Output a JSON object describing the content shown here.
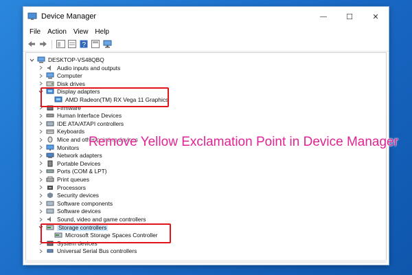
{
  "window": {
    "title": "Device Manager",
    "caption_glyphs": {
      "minimize": "—",
      "maximize": "☐",
      "close": "✕"
    }
  },
  "menu": [
    "File",
    "Action",
    "View",
    "Help"
  ],
  "toolbar_icons": [
    "back-arrow-icon",
    "forward-arrow-icon",
    "properties-icon",
    "view-list-icon",
    "help-icon",
    "details-icon",
    "computer-monitor-icon"
  ],
  "tree": {
    "root": "DESKTOP-VS48QBQ",
    "nodes": [
      {
        "label": "Audio inputs and outputs",
        "expanded": false,
        "icon": "speaker-icon"
      },
      {
        "label": "Computer",
        "expanded": false,
        "icon": "computer-icon"
      },
      {
        "label": "Disk drives",
        "expanded": false,
        "icon": "disk-icon"
      },
      {
        "label": "Display adapters",
        "expanded": true,
        "icon": "display-adapter-icon"
      },
      {
        "label": "AMD Radeon(TM) RX Vega 11 Graphics",
        "child": true,
        "icon": "display-adapter-icon"
      },
      {
        "label": "Firmware",
        "expanded": false,
        "icon": "chip-icon"
      },
      {
        "label": "Human Interface Devices",
        "expanded": false,
        "icon": "hid-icon"
      },
      {
        "label": "IDE ATA/ATAPI controllers",
        "expanded": false,
        "icon": "controller-icon"
      },
      {
        "label": "Keyboards",
        "expanded": false,
        "icon": "keyboard-icon"
      },
      {
        "label": "Mice and other pointing devices",
        "expanded": false,
        "icon": "mouse-icon"
      },
      {
        "label": "Monitors",
        "expanded": false,
        "icon": "monitor-icon"
      },
      {
        "label": "Network adapters",
        "expanded": false,
        "icon": "network-icon"
      },
      {
        "label": "Portable Devices",
        "expanded": false,
        "icon": "portable-icon"
      },
      {
        "label": "Ports (COM & LPT)",
        "expanded": false,
        "icon": "port-icon"
      },
      {
        "label": "Print queues",
        "expanded": false,
        "icon": "printer-icon"
      },
      {
        "label": "Processors",
        "expanded": false,
        "icon": "processor-icon"
      },
      {
        "label": "Security devices",
        "expanded": false,
        "icon": "security-icon"
      },
      {
        "label": "Software components",
        "expanded": false,
        "icon": "software-icon"
      },
      {
        "label": "Software devices",
        "expanded": false,
        "icon": "software-icon"
      },
      {
        "label": "Sound, video and game controllers",
        "expanded": false,
        "icon": "speaker-icon"
      },
      {
        "label": "Storage controllers",
        "expanded": true,
        "icon": "storage-icon",
        "selected": true
      },
      {
        "label": "Microsoft Storage Spaces Controller",
        "child": true,
        "icon": "storage-icon"
      },
      {
        "label": "System devices",
        "expanded": false,
        "icon": "chip-icon"
      },
      {
        "label": "Universal Serial Bus controllers",
        "expanded": false,
        "icon": "usb-icon"
      }
    ]
  },
  "overlay": {
    "text": "Remove Yellow Exclamation Point in Device Manager"
  },
  "colors": {
    "highlight_box": "#e0141b",
    "overlay_text": "#e02494",
    "background": "#1f74c8"
  }
}
